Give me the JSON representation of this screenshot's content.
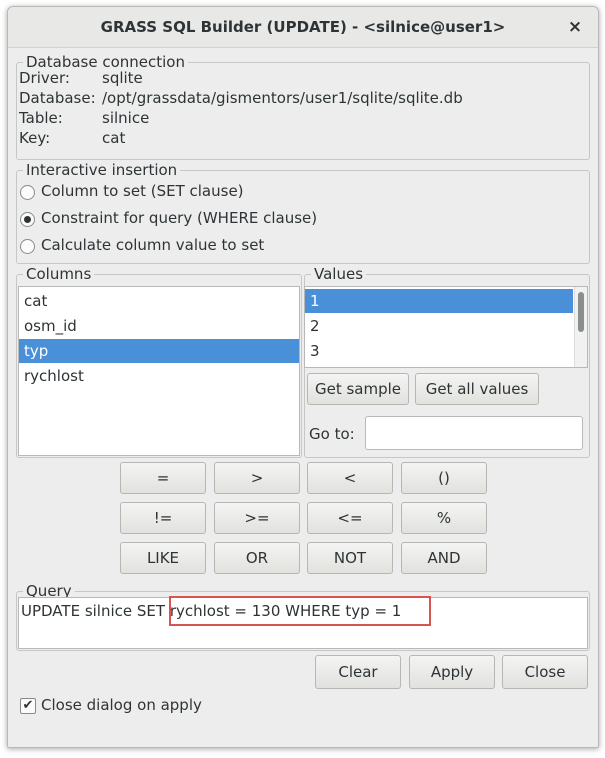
{
  "window": {
    "title": "GRASS SQL Builder (UPDATE) - <silnice@user1>",
    "close_glyph": "×"
  },
  "connection": {
    "legend": "Database connection",
    "rows": [
      {
        "label": "Driver:",
        "value": "sqlite"
      },
      {
        "label": "Database:",
        "value": "/opt/grassdata/gismentors/user1/sqlite/sqlite.db"
      },
      {
        "label": "Table:",
        "value": "silnice"
      },
      {
        "label": "Key:",
        "value": "cat"
      }
    ]
  },
  "insertion": {
    "legend": "Interactive insertion",
    "options": [
      {
        "label": "Column to set (SET clause)",
        "selected": false
      },
      {
        "label": "Constraint for query (WHERE clause)",
        "selected": true
      },
      {
        "label": "Calculate column value to set",
        "selected": false
      }
    ]
  },
  "columns": {
    "legend": "Columns",
    "items": [
      "cat",
      "osm_id",
      "typ",
      "rychlost"
    ],
    "selected_index": 2
  },
  "values": {
    "legend": "Values",
    "items": [
      "1",
      "2",
      "3"
    ],
    "selected_index": 0,
    "get_sample_label": "Get sample",
    "get_all_label": "Get all values",
    "goto_label": "Go to:",
    "goto_value": ""
  },
  "operators": {
    "row1": [
      "=",
      ">",
      "<",
      "()"
    ],
    "row2": [
      "!=",
      ">=",
      "<=",
      "%"
    ],
    "row3": [
      "LIKE",
      "OR",
      "NOT",
      "AND"
    ]
  },
  "query": {
    "legend": "Query",
    "text": "UPDATE silnice SET rychlost = 130 WHERE typ = 1",
    "highlight_color": "#d9534f"
  },
  "actions": {
    "clear_label": "Clear",
    "apply_label": "Apply",
    "close_label": "Close"
  },
  "options": {
    "close_on_apply_label": "Close dialog on apply",
    "close_on_apply_checked": true
  },
  "colors": {
    "selection": "#4a90d9",
    "window_bg": "#ededed"
  }
}
